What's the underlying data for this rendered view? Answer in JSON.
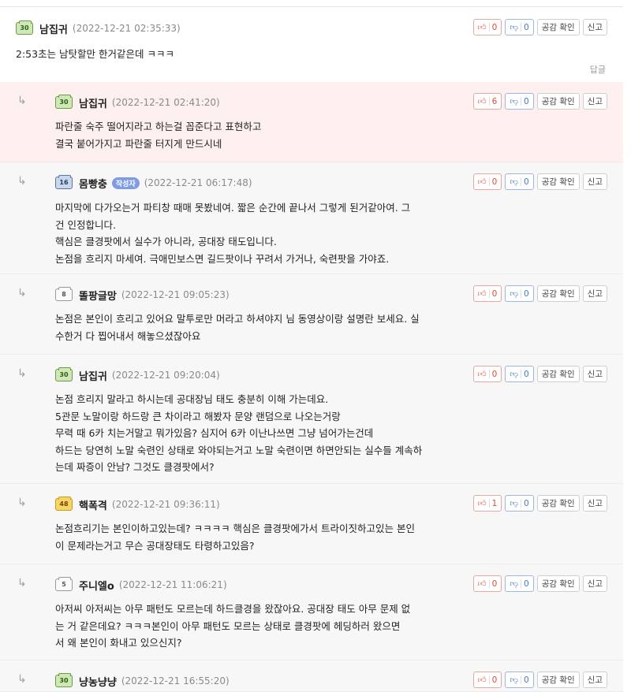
{
  "labels": {
    "agree": "공감 확인",
    "report": "신고",
    "reply": "답글"
  },
  "comments": [
    {
      "nick": "남집귀",
      "level": "30",
      "date": "(2022-12-21 02:35:33)",
      "up": "0",
      "down": "0",
      "lines": [
        "2:53초는 남탓할만 한거같은데 ㅋㅋㅋ"
      ]
    },
    {
      "nick": "남집귀",
      "level": "30",
      "date": "(2022-12-21 02:41:20)",
      "up": "6",
      "down": "0",
      "lines": [
        "파란줄 숙주 떨어지라고 하는걸 꼽준다고 표현하고",
        "결국 붙어가지고 파란줄 터지게 만드시네"
      ]
    },
    {
      "nick": "몸빵충",
      "level": "16",
      "author_badge": "작성자",
      "date": "(2022-12-21 06:17:48)",
      "up": "0",
      "down": "0",
      "lines": [
        "마지막에 다가오는거 파티창 때매 못봤네여. 짧은 순간에 끝나서 그렇게 된거같아여. 그",
        "건 인정합니다.",
        "핵심은 클경팟에서 실수가 아니라, 공대장 태도입니다.",
        "논점을 흐리지 마세여. 극애민보스면 길드팟이나 꾸려서 가거나, 숙련팟을 가야죠."
      ]
    },
    {
      "nick": "똘팡글망",
      "level": "8",
      "date": "(2022-12-21 09:05:23)",
      "up": "0",
      "down": "0",
      "lines": [
        "논점은 본인이 흐리고 있어요 말투로만 머라고 하셔야지 님 동영상이랑 설명란 보세요. 실",
        "수한거 다 찝어내서 해놓으셨잖아요"
      ]
    },
    {
      "nick": "남집귀",
      "level": "30",
      "date": "(2022-12-21 09:20:04)",
      "up": "0",
      "down": "0",
      "lines": [
        "논점 흐리지 말라고 하시는데 공대장님 태도 충분히 이해 가는데요.",
        "5관문 노말이랑 하드랑 큰 차이라고 해봤자 문양 랜덤으로 나오는거랑",
        "무력 때 6카 치는거말고 뭐가있음? 심지어 6카 이난나쓰면 그냥 넘어가는건데",
        "하드는 당연히 노말 숙련인 상태로 와야되는거고 노말 숙련이면 하면안되는 실수들 계속하",
        "는데 짜증이 안남? 그것도 클경팟에서?"
      ]
    },
    {
      "nick": "핵폭격",
      "level": "48",
      "date": "(2022-12-21 09:36:11)",
      "up": "1",
      "down": "0",
      "lines": [
        "논점흐리기는 본인이하고있는데? ㅋㅋㅋㅋ 핵심은 클경팟에가서 트라이짓하고있는 본인",
        "이 문제라는거고 무슨 공대장태도 타령하고있음?"
      ]
    },
    {
      "nick": "주니엘o",
      "level": "5",
      "date": "(2022-12-21 11:06:21)",
      "up": "0",
      "down": "0",
      "lines": [
        "아저씨 아저씨는 아무 패턴도 모르는데 하드클경을 왔잖아요. 공대장 태도 아무 문제 없",
        "는 거 같은데요? ㅋㅋㅋ본인이 아무 패턴도 모르는 상태로 클경팟에 헤딩하러 왔으면",
        "서 왜 본인이 화내고 있으신지?"
      ]
    },
    {
      "nick": "냥농냥냥",
      "level": "30",
      "date": "(2022-12-21 16:55:20)",
      "up": "0",
      "down": "0",
      "lines": []
    }
  ],
  "colors": {
    "upvote": "#e0493c",
    "downvote": "#4a78cc",
    "highlight_bg": "#fdf0ee",
    "reply_bg": "#f7f7f7"
  },
  "icons": {
    "reply_arrow": "reply-arrow-icon",
    "up": "thumbs-up-icon",
    "down": "thumbs-down-icon",
    "level": "level-badge-icon"
  }
}
